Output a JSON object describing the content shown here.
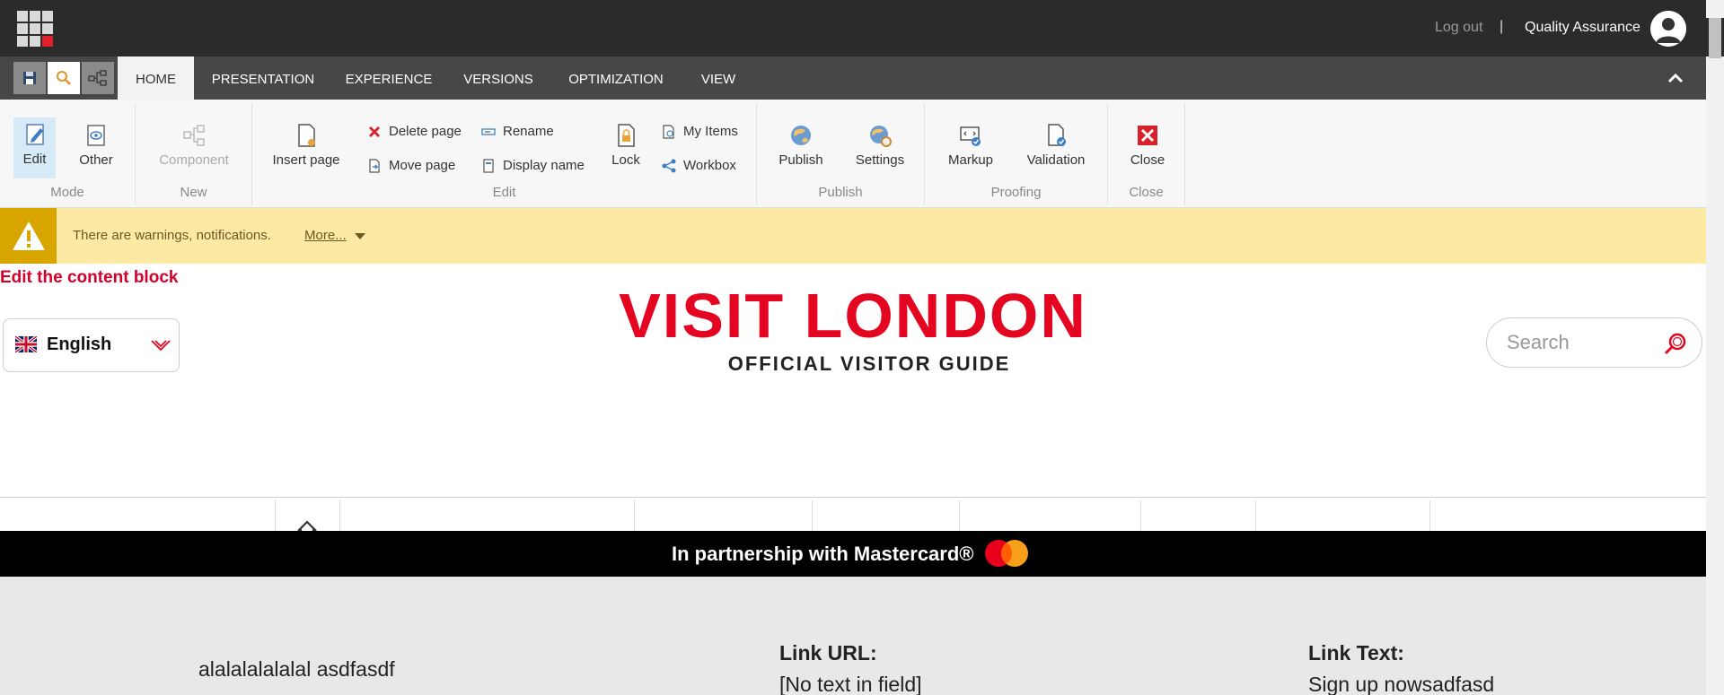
{
  "topbar": {
    "logout_label": "Log out",
    "separator": "|",
    "username": "Quality Assurance"
  },
  "tabs": [
    {
      "label": "HOME",
      "active": true
    },
    {
      "label": "PRESENTATION"
    },
    {
      "label": "EXPERIENCE"
    },
    {
      "label": "VERSIONS"
    },
    {
      "label": "OPTIMIZATION"
    },
    {
      "label": "VIEW"
    }
  ],
  "ribbon": {
    "mode": {
      "label": "Mode",
      "edit": "Edit",
      "other": "Other"
    },
    "new": {
      "label": "New",
      "component": "Component"
    },
    "edit": {
      "label": "Edit",
      "insert_page": "Insert page",
      "delete_page": "Delete page",
      "move_page": "Move page",
      "rename": "Rename",
      "display_name": "Display name",
      "lock": "Lock",
      "my_items": "My Items",
      "workbox": "Workbox"
    },
    "publish": {
      "label": "Publish",
      "publish": "Publish",
      "settings": "Settings"
    },
    "proofing": {
      "label": "Proofing",
      "markup": "Markup",
      "validation": "Validation"
    },
    "close": {
      "label": "Close",
      "close": "Close"
    }
  },
  "warning": {
    "text": "There are warnings, notifications.",
    "more": "More..."
  },
  "page": {
    "edit_hint": "Edit the content block",
    "language": "English",
    "brand_title": "VISIT LONDON",
    "brand_subtitle": "OFFICIAL VISITOR GUIDE",
    "search_placeholder": "Search",
    "partner_text": "In partnership with Mastercard®",
    "body_text": "alalalalalalal asdfasdf",
    "link_url_label": "Link URL:",
    "link_url_value": "[No text in field]",
    "link_text_label": "Link Text:",
    "link_text_value": "Sign up nowsadfasd"
  },
  "colors": {
    "brand_red": "#e40520",
    "warning_bg": "#fce9a3",
    "topbar_bg": "#2b2b2b",
    "tabbar_bg": "#474747"
  }
}
